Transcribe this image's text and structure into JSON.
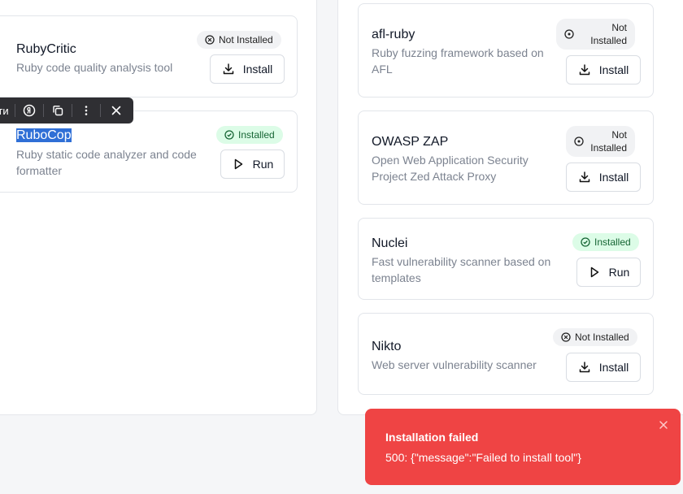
{
  "left_column": {
    "tools": [
      {
        "name": "RubyCritic",
        "description": "Ruby code quality analysis tool",
        "status": "Not Installed",
        "action": "Install"
      },
      {
        "name": "RuboCop",
        "description": "Ruby static code analyzer and code formatter",
        "status": "Installed",
        "action": "Run"
      }
    ]
  },
  "right_column": {
    "tools": [
      {
        "name": "afl-ruby",
        "description": "Ruby fuzzing framework based on AFL",
        "status_line1": "Not",
        "status_line2": "Installed",
        "action": "Install"
      },
      {
        "name": "OWASP ZAP",
        "description": "Open Web Application Security Project Zed Attack Proxy",
        "status_line1": "Not",
        "status_line2": "Installed",
        "action": "Install"
      },
      {
        "name": "Nuclei",
        "description": "Fast vulnerability scanner based on templates",
        "status": "Installed",
        "action": "Run"
      },
      {
        "name": "Nikto",
        "description": "Web server vulnerability scanner",
        "status": "Not Installed",
        "action": "Install"
      }
    ]
  },
  "selection_toolbar": {
    "partial_label": "ти",
    "icons": [
      "yandex-icon",
      "copy-icon",
      "more-icon",
      "close-icon"
    ]
  },
  "toast": {
    "title": "Installation failed",
    "message": "500: {\"message\":\"Failed to install tool\"}"
  },
  "colors": {
    "toast_background": "#ef4444",
    "installed_badge": "#dcfce7",
    "selection_highlight": "#2f6fd6"
  }
}
